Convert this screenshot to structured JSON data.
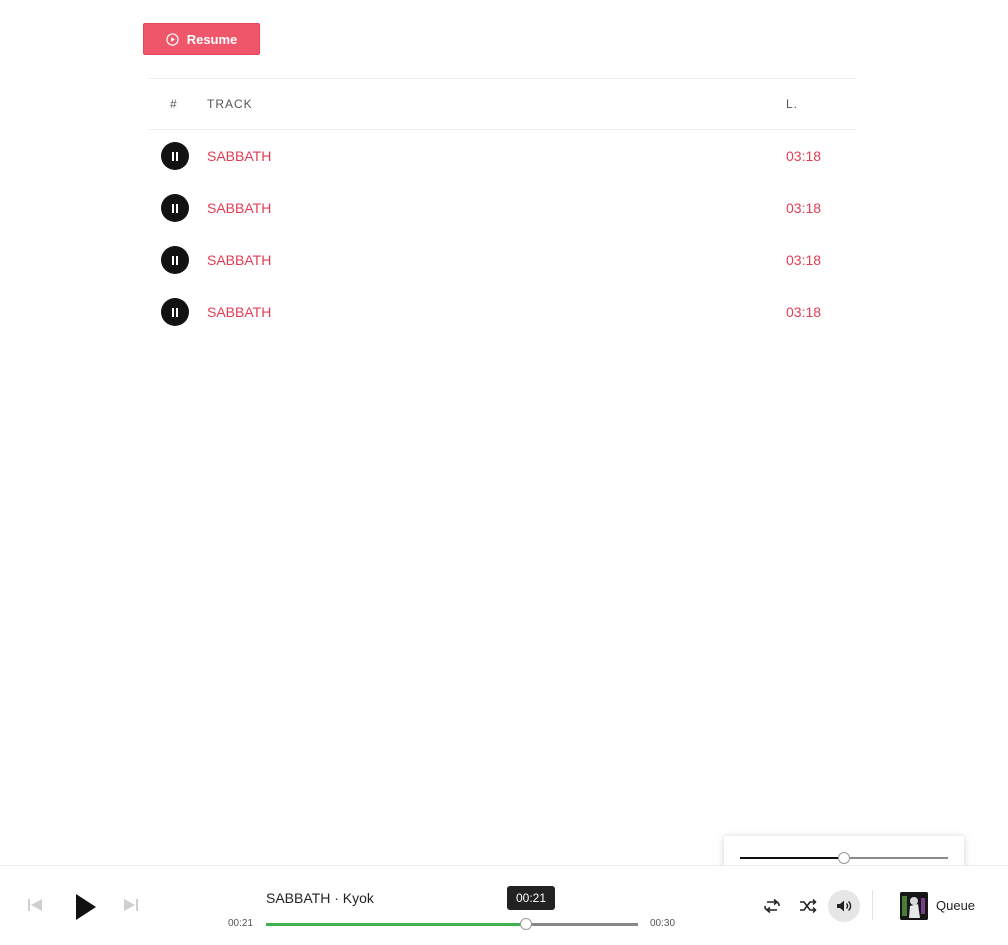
{
  "resume_button": {
    "label": "Resume"
  },
  "table": {
    "headers": {
      "num": "#",
      "track": "TRACK",
      "length": "L."
    },
    "rows": [
      {
        "title": "SABBATH",
        "length": "03:18"
      },
      {
        "title": "SABBATH",
        "length": "03:18"
      },
      {
        "title": "SABBATH",
        "length": "03:18"
      },
      {
        "title": "SABBATH",
        "length": "03:18"
      }
    ]
  },
  "player": {
    "now_playing": "SABBATH · Kyok",
    "current_time": "00:21",
    "total_time": "00:30",
    "tooltip_time": "00:21",
    "progress_fraction": 0.7,
    "volume_fraction": 0.5,
    "queue_label": "Queue",
    "icons": [
      "prev-icon",
      "play-icon",
      "next-icon",
      "repeat-icon",
      "shuffle-icon",
      "volume-icon"
    ]
  },
  "colors": {
    "accent": "#f0566a",
    "link": "#e53c53",
    "progress": "#3fb24f"
  }
}
